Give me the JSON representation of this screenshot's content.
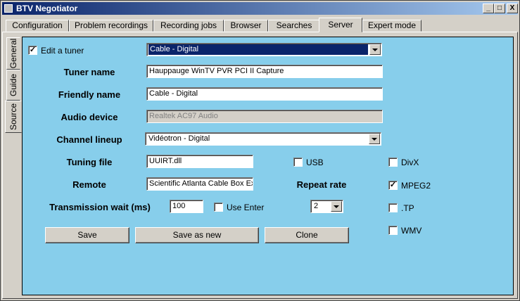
{
  "window": {
    "title": "BTV Negotiator"
  },
  "tabs": [
    "Configuration",
    "Problem recordings",
    "Recording jobs",
    "Browser",
    "Searches",
    "Server",
    "Expert mode"
  ],
  "active_tab": "Server",
  "side_tabs": [
    "General",
    "Guide",
    "Source"
  ],
  "active_side_tab": "Source",
  "form": {
    "edit_tuner": {
      "label": "Edit a tuner",
      "checked": true,
      "value": "Cable - Digital"
    },
    "tuner_name": {
      "label": "Tuner name",
      "value": "Hauppauge WinTV PVR PCI II Capture"
    },
    "friendly_name": {
      "label": "Friendly name",
      "value": "Cable - Digital"
    },
    "audio_device": {
      "label": "Audio device",
      "value": "Realtek AC97 Audio"
    },
    "channel_lineup": {
      "label": "Channel lineup",
      "value": "Vidéotron - Digital"
    },
    "tuning_file": {
      "label": "Tuning file",
      "value": "UUIRT.dll"
    },
    "remote": {
      "label": "Remote",
      "value": "Scientific Atlanta Cable Box Ex"
    },
    "transmission_wait": {
      "label": "Transmission wait (ms)",
      "value": "100"
    },
    "use_enter": {
      "label": "Use Enter",
      "checked": false
    },
    "usb": {
      "label": "USB",
      "checked": false
    },
    "repeat_rate": {
      "label": "Repeat rate",
      "value": "2"
    },
    "divx": {
      "label": "DivX",
      "checked": false
    },
    "mpeg2": {
      "label": "MPEG2",
      "checked": true
    },
    "tp": {
      "label": ".TP",
      "checked": false
    },
    "wmv": {
      "label": "WMV",
      "checked": false
    }
  },
  "buttons": {
    "save": "Save",
    "save_as_new": "Save as new",
    "clone": "Clone"
  },
  "title_buttons": {
    "minimize": "_",
    "maximize": "□",
    "close": "X"
  }
}
